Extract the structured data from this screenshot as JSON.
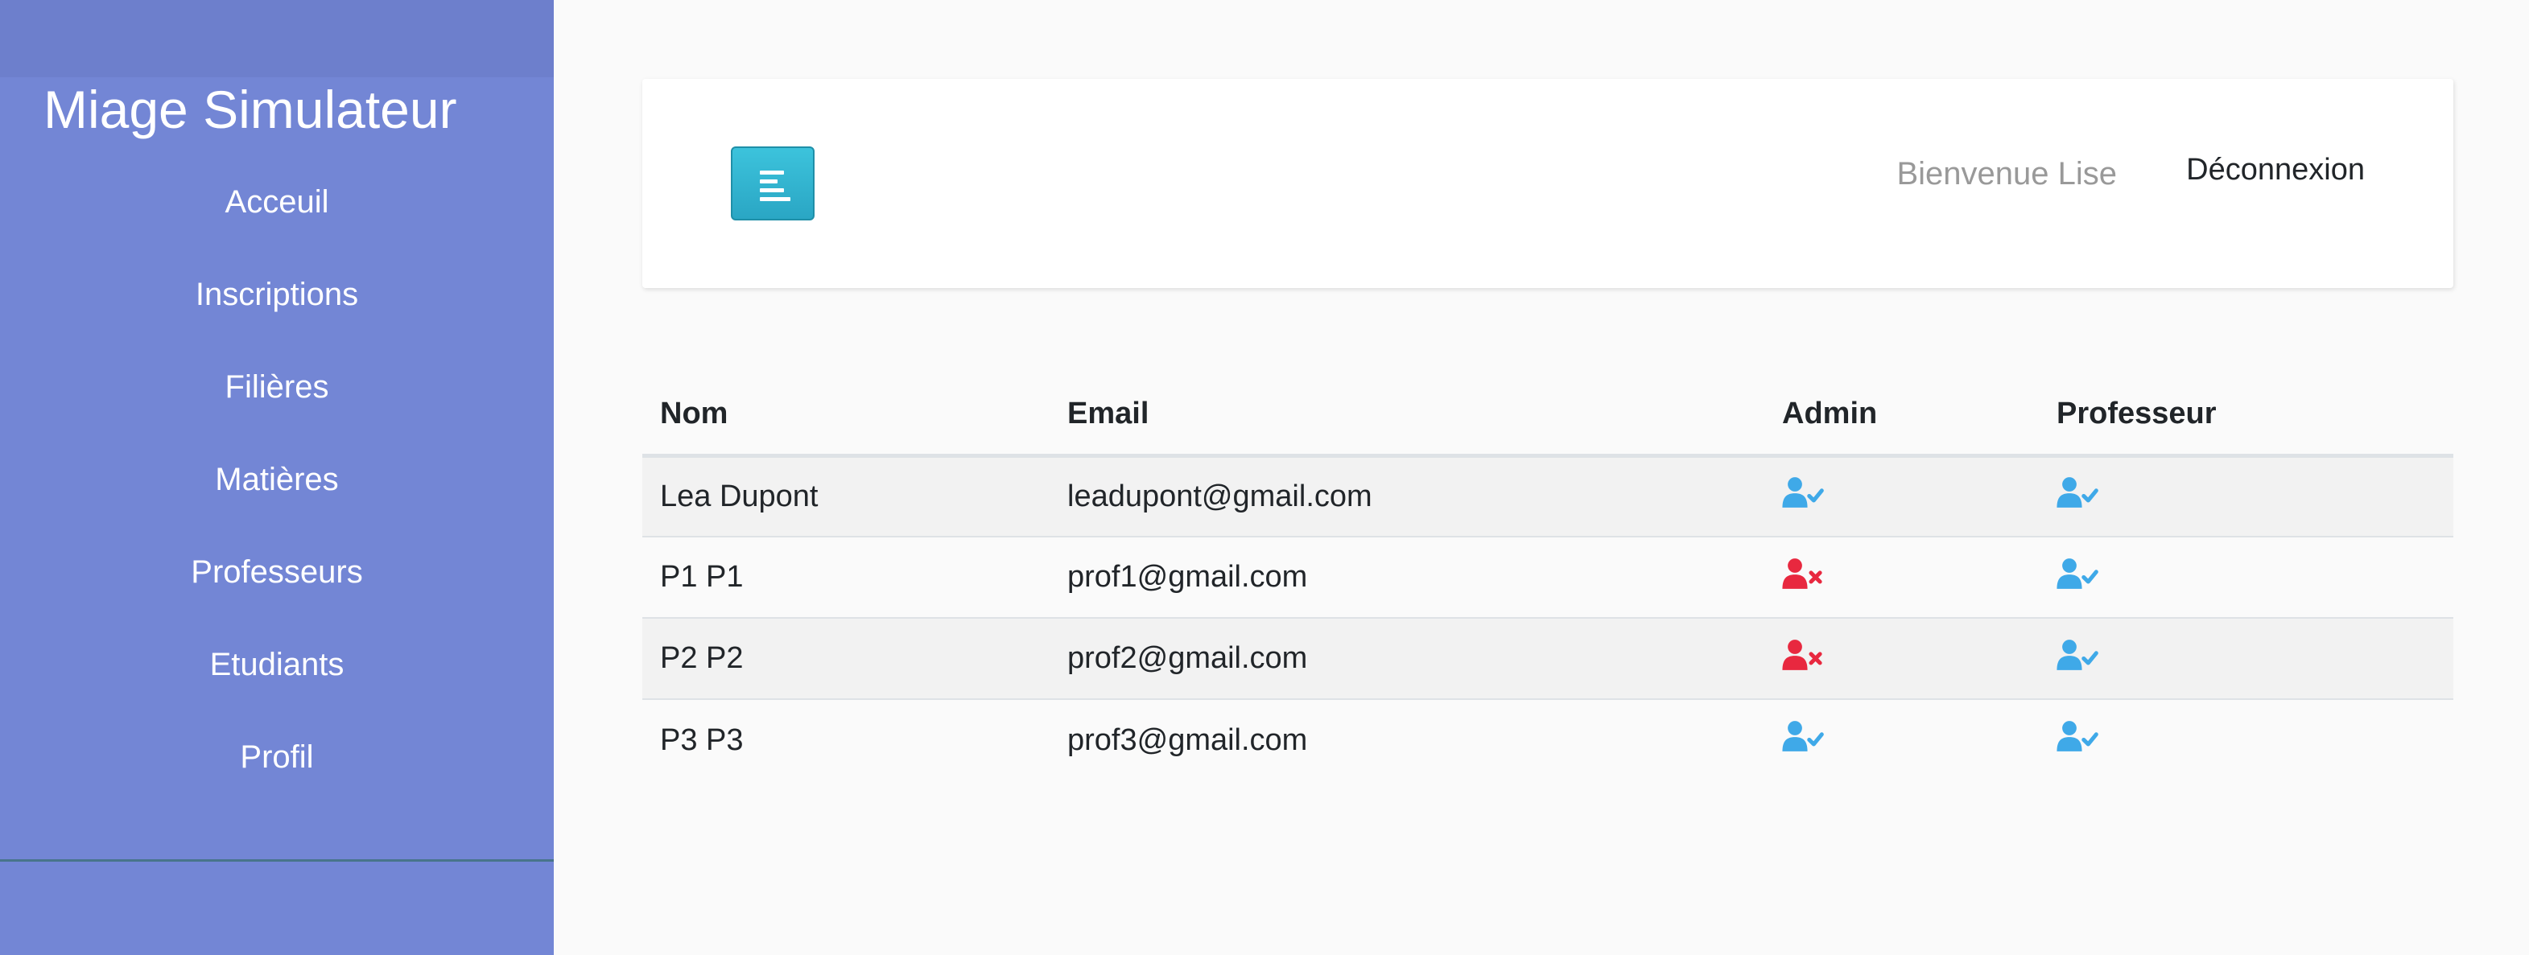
{
  "sidebar": {
    "title": "Miage Simulateur",
    "items": [
      {
        "label": "Acceuil"
      },
      {
        "label": "Inscriptions"
      },
      {
        "label": "Filières"
      },
      {
        "label": "Matières"
      },
      {
        "label": "Professeurs"
      },
      {
        "label": "Etudiants"
      },
      {
        "label": "Profil"
      }
    ]
  },
  "header": {
    "toggle_icon": "align-left-icon",
    "welcome": "Bienvenue Lise",
    "logout": "Déconnexion"
  },
  "table": {
    "columns": [
      "Nom",
      "Email",
      "Admin",
      "Professeur"
    ],
    "rows": [
      {
        "nom": "Lea Dupont",
        "email": "leadupont@gmail.com",
        "admin": "user-check-icon",
        "professeur": "user-check-icon"
      },
      {
        "nom": "P1 P1",
        "email": "prof1@gmail.com",
        "admin": "user-times-icon",
        "professeur": "user-check-icon"
      },
      {
        "nom": "P2 P2",
        "email": "prof2@gmail.com",
        "admin": "user-times-icon",
        "professeur": "user-check-icon"
      },
      {
        "nom": "P3 P3",
        "email": "prof3@gmail.com",
        "admin": "user-check-icon",
        "professeur": "user-check-icon"
      }
    ]
  },
  "colors": {
    "sidebar": "#7386d5",
    "check": "#3fa9e8",
    "times": "#e8283f",
    "toggle": "#17a2b8"
  }
}
